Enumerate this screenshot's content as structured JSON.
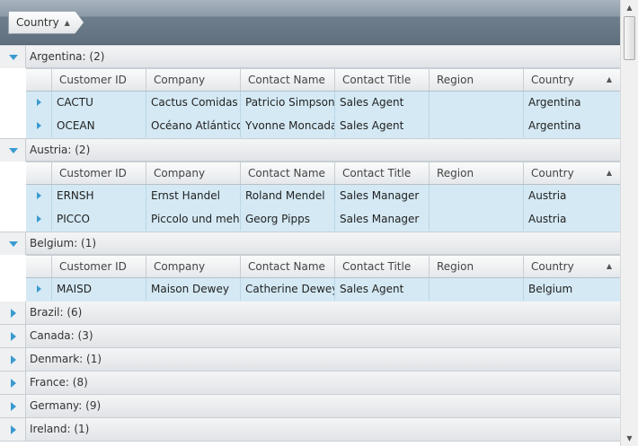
{
  "group_panel": {
    "chip_label": "Country"
  },
  "columns": [
    "Customer ID",
    "Company",
    "Contact Name",
    "Contact Title",
    "Region",
    "Country"
  ],
  "expanded_groups": [
    {
      "label": "Argentina: (2)",
      "rows": [
        [
          "CACTU",
          "Cactus Comidas para llevar",
          "Patricio Simpson",
          "Sales Agent",
          "",
          "Argentina"
        ],
        [
          "OCEAN",
          "Océano Atlántico Ltda.",
          "Yvonne Moncada",
          "Sales Agent",
          "",
          "Argentina"
        ]
      ]
    },
    {
      "label": "Austria: (2)",
      "rows": [
        [
          "ERNSH",
          "Ernst Handel",
          "Roland Mendel",
          "Sales Manager",
          "",
          "Austria"
        ],
        [
          "PICCO",
          "Piccolo und mehr",
          "Georg Pipps",
          "Sales Manager",
          "",
          "Austria"
        ]
      ]
    },
    {
      "label": "Belgium: (1)",
      "rows": [
        [
          "MAISD",
          "Maison Dewey",
          "Catherine Dewey",
          "Sales Agent",
          "",
          "Belgium"
        ]
      ]
    }
  ],
  "collapsed_groups": [
    "Brazil: (6)",
    "Canada: (3)",
    "Denmark: (1)",
    "France: (8)",
    "Germany: (9)",
    "Ireland: (1)"
  ]
}
